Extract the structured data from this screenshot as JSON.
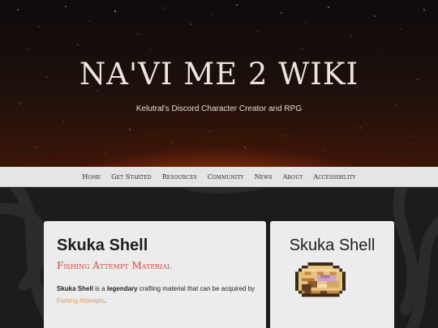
{
  "site": {
    "title": "NA'VI ME 2 WIKI",
    "subtitle": "Kelutral's Discord Character Creator and RPG"
  },
  "nav": {
    "items": [
      {
        "label": "Home"
      },
      {
        "label": "Get Started"
      },
      {
        "label": "Resources"
      },
      {
        "label": "Community"
      },
      {
        "label": "News"
      },
      {
        "label": "About"
      },
      {
        "label": "Accessibility"
      }
    ]
  },
  "page": {
    "title": "Skuka Shell",
    "subtitle": "Fishing Attempt Material",
    "desc": {
      "name": "Skuka Shell",
      "part1": " is a ",
      "rarity": "legendary",
      "part2": " crafting material that can be acquired by ",
      "link": "Fishing Attempts",
      "end": "."
    }
  },
  "infobox": {
    "title": "Skuka Shell",
    "image_icon": "skuka-shell-icon"
  },
  "colors": {
    "accent_red": "#e0473f",
    "link_orange": "#e89a54",
    "nav_bg": "#e5e5e5",
    "card_bg": "#ececec"
  }
}
